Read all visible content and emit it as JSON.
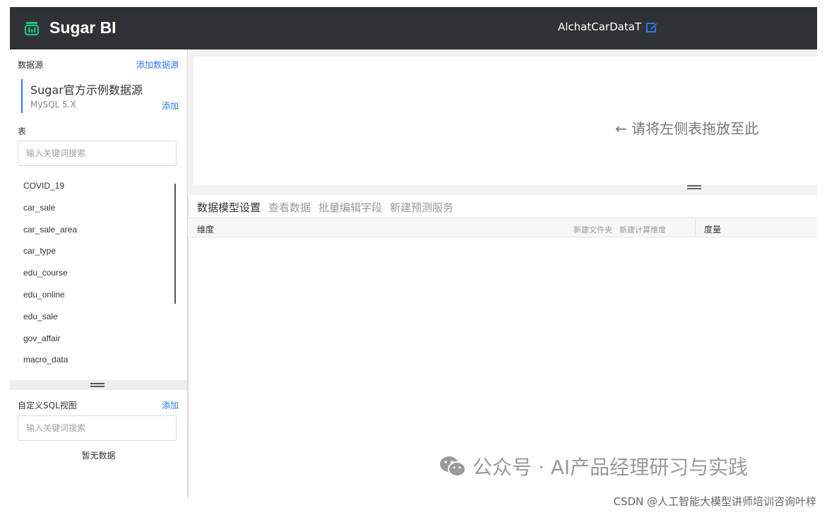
{
  "app": {
    "name": "Sugar BI",
    "project_title": "AlchatCarDataT"
  },
  "sidebar": {
    "datasource_heading": "数据源",
    "add_datasource": "添加数据源",
    "datasource": {
      "name": "Sugar官方示例数据源",
      "type": "MySQL 5.X",
      "add": "添加"
    },
    "tables_heading": "表",
    "table_search_placeholder": "输入关键词搜索",
    "tables": [
      "COVID_19",
      "car_sale",
      "car_sale_area",
      "car_type",
      "edu_course",
      "edu_online",
      "edu_sale",
      "gov_affair",
      "macro_data"
    ],
    "sql_heading": "自定义SQL视图",
    "sql_add": "添加",
    "sql_search_placeholder": "输入关键词搜索",
    "sql_empty": "暂无数据"
  },
  "canvas": {
    "drop_hint": "请将左侧表拖放至此"
  },
  "tabs": [
    {
      "label": "数据模型设置",
      "active": true
    },
    {
      "label": "查看数据",
      "active": false
    },
    {
      "label": "批量编辑字段",
      "active": false
    },
    {
      "label": "新建预测服务",
      "active": false
    }
  ],
  "fields": {
    "dimension_label": "维度",
    "new_folder": "新建文件夹",
    "new_calc_dimension": "新建计算维度",
    "measure_label": "度量"
  },
  "overlay": {
    "watermark": "公众号 · AI产品经理研习与实践",
    "credit": "CSDN @人工智能大模型讲师培训咨询叶梓"
  },
  "colors": {
    "header_bg": "#2f3235",
    "accent": "#2e77f0",
    "logo_green": "#1bbf8a"
  }
}
